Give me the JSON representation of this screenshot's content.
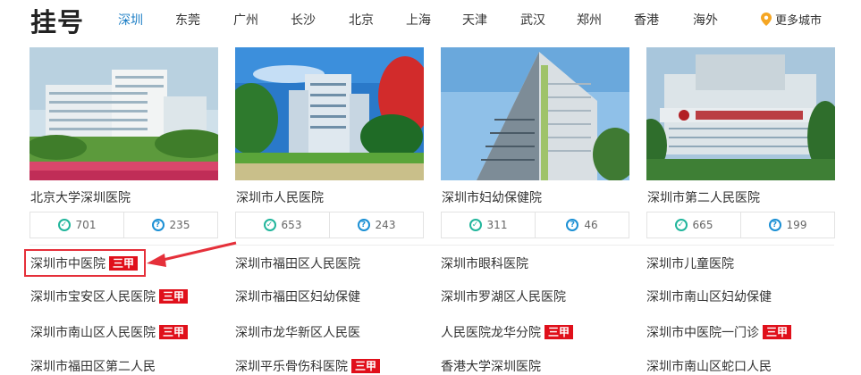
{
  "header": {
    "title": "挂号",
    "tabs": [
      "深圳",
      "东莞",
      "广州",
      "长沙",
      "北京",
      "上海",
      "天津",
      "武汉",
      "郑州",
      "香港",
      "海外"
    ],
    "more_cities": "更多城市"
  },
  "colors": {
    "active_tab": "#1c7ec5",
    "badge": "#e0101b",
    "highlight": "#e5303a"
  },
  "cards": [
    {
      "name": "北京大学深圳医院",
      "stat1": "701",
      "stat2": "235"
    },
    {
      "name": "深圳市人民医院",
      "stat1": "653",
      "stat2": "243"
    },
    {
      "name": "深圳市妇幼保健院",
      "stat1": "311",
      "stat2": "46"
    },
    {
      "name": "深圳市第二人民医院",
      "stat1": "665",
      "stat2": "199"
    }
  ],
  "badge_text": "三甲",
  "hospitals": [
    {
      "name": "深圳市中医院",
      "badge": true
    },
    {
      "name": "深圳市福田区人民医院",
      "badge": false
    },
    {
      "name": "深圳市眼科医院",
      "badge": false
    },
    {
      "name": "深圳市儿童医院",
      "badge": false
    },
    {
      "name": "深圳市宝安区人民医院",
      "badge": true
    },
    {
      "name": "深圳市福田区妇幼保健",
      "badge": false
    },
    {
      "name": "深圳市罗湖区人民医院",
      "badge": false
    },
    {
      "name": "深圳市南山区妇幼保健",
      "badge": false
    },
    {
      "name": "深圳市南山区人民医院",
      "badge": true
    },
    {
      "name": "深圳市龙华新区人民医",
      "badge": false
    },
    {
      "name": "人民医院龙华分院",
      "badge": true
    },
    {
      "name": "深圳市中医院一门诊",
      "badge": true
    },
    {
      "name": "深圳市福田区第二人民",
      "badge": false
    },
    {
      "name": "深圳平乐骨伤科医院",
      "badge": true
    },
    {
      "name": "香港大学深圳医院",
      "badge": false
    },
    {
      "name": "深圳市南山区蛇口人民",
      "badge": false
    }
  ]
}
